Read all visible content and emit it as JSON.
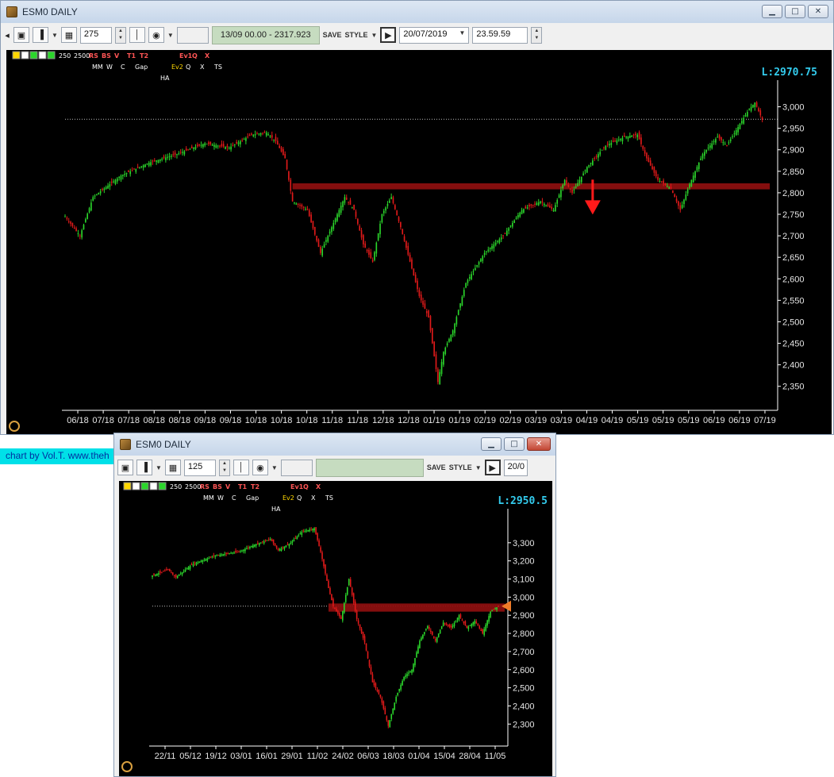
{
  "win1": {
    "title": "ESM0 DAILY",
    "bars_count": "275",
    "cursor_readout": "13/09 00.00 - 2317.923",
    "save_label": "SAVE",
    "style_label": "STYLE",
    "date_value": "20/07/2019",
    "time_value": "23.59.59",
    "last_price_label": "L:2970.75",
    "footer_text": "chart by Vol.T. www.theh"
  },
  "win2": {
    "title": "ESM0 DAILY",
    "bars_count": "125",
    "save_label": "SAVE",
    "style_label": "STYLE",
    "date_value": "20/0",
    "last_price_label": "L:2950.5"
  },
  "tool_icons": {
    "row1": [
      "250",
      "2500",
      "RS",
      "BS",
      "V",
      "T1",
      "T2",
      "Ev1",
      "Q",
      "X"
    ],
    "row2": [
      "MM",
      "W",
      "C",
      "Gap",
      "Ev2",
      "Q",
      "X",
      "TS"
    ],
    "row3": [
      "HA"
    ]
  },
  "colors": {
    "up": "#2bd62b",
    "down": "#e01a1a",
    "band": "#8b0f0f",
    "price_label": "#33ccee",
    "arrow": "#ff1a1a",
    "marker": "#f07c28",
    "axis_text": "#e6e6e6"
  },
  "chart_data": [
    {
      "type": "candlestick",
      "title": "",
      "last_price": 2970.75,
      "y_ticks": [
        3000,
        2950,
        2900,
        2850,
        2800,
        2750,
        2700,
        2650,
        2600,
        2550,
        2500,
        2450,
        2400,
        2350
      ],
      "y_tick_labels": [
        "3,000",
        "2,950",
        "2,900",
        "2,850",
        "2,800",
        "2,750",
        "2,700",
        "2,650",
        "2,600",
        "2,550",
        "2,500",
        "2,450",
        "2,400",
        "2,350"
      ],
      "ylim": [
        2320,
        3025
      ],
      "x_tick_labels": [
        "06/18",
        "07/18",
        "07/18",
        "08/18",
        "08/18",
        "09/18",
        "09/18",
        "10/18",
        "10/18",
        "10/18",
        "11/18",
        "11/18",
        "12/18",
        "12/18",
        "01/19",
        "01/19",
        "02/19",
        "02/19",
        "03/19",
        "03/19",
        "04/19",
        "04/19",
        "05/19",
        "05/19",
        "05/19",
        "06/19",
        "06/19",
        "07/19"
      ],
      "close_path": [
        [
          0,
          2745
        ],
        [
          8,
          2700
        ],
        [
          15,
          2790
        ],
        [
          30,
          2840
        ],
        [
          45,
          2870
        ],
        [
          60,
          2890
        ],
        [
          75,
          2915
        ],
        [
          88,
          2905
        ],
        [
          100,
          2935
        ],
        [
          108,
          2940
        ],
        [
          113,
          2920
        ],
        [
          118,
          2880
        ],
        [
          122,
          2780
        ],
        [
          130,
          2760
        ],
        [
          137,
          2660
        ],
        [
          145,
          2740
        ],
        [
          150,
          2790
        ],
        [
          155,
          2760
        ],
        [
          160,
          2680
        ],
        [
          165,
          2640
        ],
        [
          170,
          2750
        ],
        [
          175,
          2790
        ],
        [
          180,
          2720
        ],
        [
          185,
          2640
        ],
        [
          190,
          2560
        ],
        [
          195,
          2510
        ],
        [
          200,
          2360
        ],
        [
          203,
          2430
        ],
        [
          208,
          2480
        ],
        [
          215,
          2590
        ],
        [
          225,
          2660
        ],
        [
          235,
          2700
        ],
        [
          245,
          2760
        ],
        [
          255,
          2780
        ],
        [
          262,
          2760
        ],
        [
          268,
          2830
        ],
        [
          272,
          2800
        ],
        [
          280,
          2860
        ],
        [
          290,
          2910
        ],
        [
          300,
          2930
        ],
        [
          307,
          2935
        ],
        [
          312,
          2880
        ],
        [
          318,
          2830
        ],
        [
          325,
          2810
        ],
        [
          330,
          2760
        ],
        [
          335,
          2820
        ],
        [
          342,
          2890
        ],
        [
          350,
          2930
        ],
        [
          355,
          2910
        ],
        [
          362,
          2960
        ],
        [
          367,
          2995
        ],
        [
          370,
          3010
        ],
        [
          374,
          2970
        ]
      ],
      "band": {
        "y_low": 2808,
        "y_high": 2822,
        "from_index": 122,
        "to_index": 374
      },
      "dotted_level": 2971,
      "annotation": "down-arrow"
    },
    {
      "type": "candlestick",
      "title": "",
      "last_price": 2950.5,
      "y_ticks": [
        3300,
        3200,
        3100,
        3000,
        2900,
        2800,
        2700,
        2600,
        2500,
        2400,
        2300
      ],
      "y_tick_labels": [
        "3,300",
        "3,200",
        "3,100",
        "3,000",
        "2,900",
        "2,800",
        "2,700",
        "2,600",
        "2,500",
        "2,400",
        "2,300"
      ],
      "ylim": [
        2240,
        3400
      ],
      "x_tick_labels": [
        "22/11",
        "05/12",
        "19/12",
        "03/01",
        "16/01",
        "29/01",
        "11/02",
        "24/02",
        "06/03",
        "18/03",
        "01/04",
        "15/04",
        "28/04",
        "11/05"
      ],
      "close_path": [
        [
          0,
          3120
        ],
        [
          10,
          3150
        ],
        [
          15,
          3110
        ],
        [
          25,
          3180
        ],
        [
          40,
          3230
        ],
        [
          55,
          3250
        ],
        [
          65,
          3290
        ],
        [
          75,
          3320
        ],
        [
          80,
          3260
        ],
        [
          88,
          3300
        ],
        [
          95,
          3360
        ],
        [
          103,
          3380
        ],
        [
          107,
          3250
        ],
        [
          112,
          3050
        ],
        [
          115,
          2950
        ],
        [
          120,
          2880
        ],
        [
          125,
          3100
        ],
        [
          130,
          2880
        ],
        [
          135,
          2750
        ],
        [
          140,
          2530
        ],
        [
          145,
          2450
        ],
        [
          150,
          2290
        ],
        [
          155,
          2450
        ],
        [
          160,
          2560
        ],
        [
          165,
          2600
        ],
        [
          170,
          2760
        ],
        [
          175,
          2840
        ],
        [
          180,
          2760
        ],
        [
          185,
          2860
        ],
        [
          190,
          2830
        ],
        [
          195,
          2900
        ],
        [
          200,
          2830
        ],
        [
          205,
          2870
        ],
        [
          210,
          2800
        ],
        [
          215,
          2920
        ],
        [
          220,
          2950
        ]
      ],
      "band": {
        "y_low": 2920,
        "y_high": 2965,
        "from_index": 112,
        "to_index": 220
      },
      "dotted_level": 2950,
      "annotation": "right-marker"
    }
  ]
}
